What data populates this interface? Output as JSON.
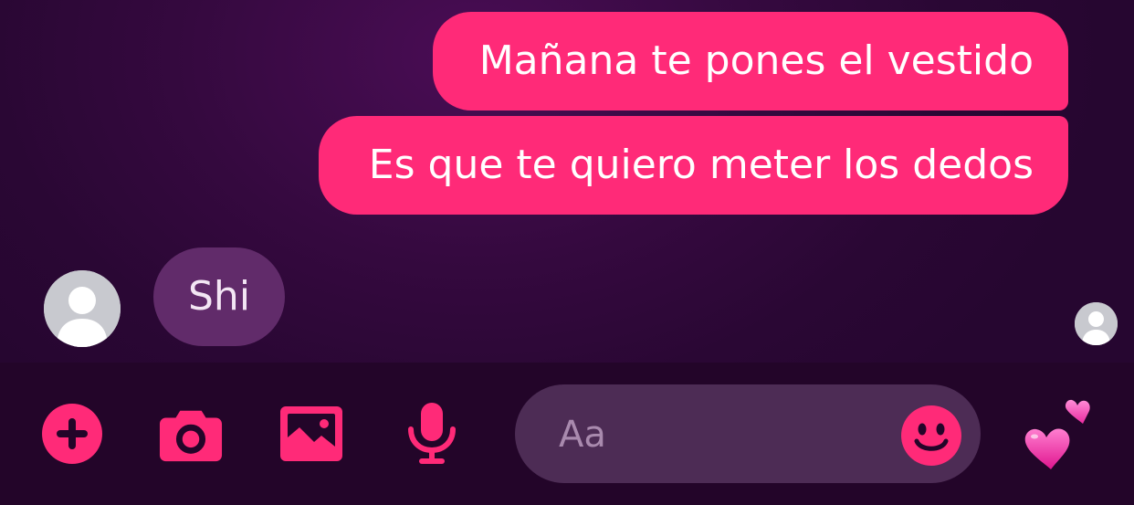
{
  "thread": {
    "messages": [
      {
        "from": "me",
        "text": "Mañana te pones el vestido"
      },
      {
        "from": "me",
        "text": "Es que te quiero meter los dedos"
      },
      {
        "from": "them",
        "text": "Shi"
      }
    ]
  },
  "composer": {
    "placeholder": "Aa",
    "icons": [
      "plus-circle-icon",
      "camera-icon",
      "image-icon",
      "microphone-icon",
      "smiley-icon",
      "two-hearts-icon"
    ]
  },
  "colors": {
    "accent": "#ff2a78",
    "incoming_bubble": "#612b6a",
    "background": "#2a0734",
    "composer_bar": "#230529",
    "input_field": "#4d2c55"
  }
}
